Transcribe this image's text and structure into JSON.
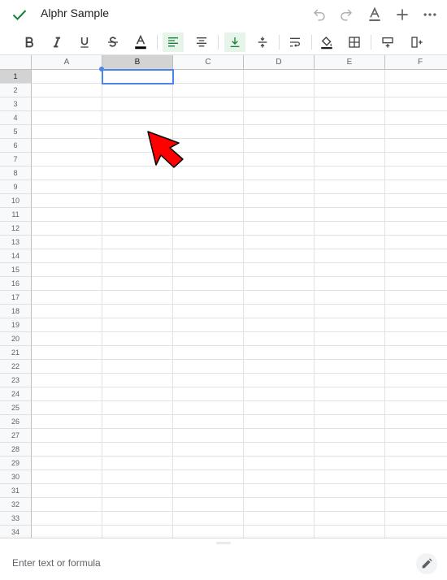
{
  "app": {
    "title": "Alphr Sample"
  },
  "top_actions": [
    "undo-icon",
    "redo-icon",
    "text-format-icon",
    "add-icon",
    "more-icon"
  ],
  "toolbar": {
    "items": [
      "bold-icon",
      "italic-icon",
      "underline-icon",
      "strikethrough-icon",
      "text-color-icon",
      "align-left-icon",
      "align-center-icon",
      "valign-bottom-icon",
      "valign-middle-icon",
      "wrap-text-icon",
      "fill-color-icon",
      "borders-icon",
      "insert-row-icon",
      "insert-column-icon"
    ],
    "active": [
      "align-left-icon",
      "valign-bottom-icon"
    ],
    "text_color": "#000000",
    "accent": "#188038"
  },
  "sheet": {
    "columns": [
      "A",
      "B",
      "C",
      "D",
      "E",
      "F"
    ],
    "rows": [
      "1",
      "2",
      "3",
      "4",
      "5",
      "6",
      "7",
      "8",
      "9",
      "10",
      "11",
      "12",
      "13",
      "14",
      "15",
      "16",
      "17",
      "18",
      "19",
      "20",
      "21",
      "22",
      "23",
      "24",
      "25",
      "26",
      "27",
      "28",
      "29",
      "30",
      "31",
      "32",
      "33",
      "34"
    ],
    "selected_cell": "B1",
    "selection_color": "#4a86e8"
  },
  "annotation": {
    "arrow_color": "#ff0000"
  },
  "formula_bar": {
    "placeholder": "Enter text or formula"
  }
}
